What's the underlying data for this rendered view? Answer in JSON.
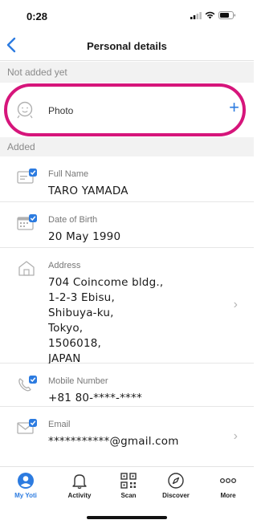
{
  "status_bar": {
    "time": "0:28",
    "icons": [
      "signal-icon",
      "wifi-icon",
      "battery-icon"
    ]
  },
  "header": {
    "title": "Personal details",
    "back_icon": "chevron-left-icon"
  },
  "sections": {
    "not_added": "Not added yet",
    "added": "Added"
  },
  "photo": {
    "label": "Photo",
    "add_label": "+"
  },
  "details": [
    {
      "label": "Full Name",
      "value": "TARO YAMADA",
      "icon": "id-card-verified-icon",
      "chevron": ""
    },
    {
      "label": "Date of Birth",
      "value": "20 May 1990",
      "icon": "calendar-verified-icon",
      "chevron": ""
    },
    {
      "label": "Address",
      "value": "704 Coincome bldg.,\n1-2-3 Ebisu,\nShibuya-ku,\nTokyo,\n1506018,\nJAPAN",
      "icon": "house-icon",
      "chevron": "›"
    },
    {
      "label": "Mobile Number",
      "value": "+81 80-****-****",
      "icon": "phone-verified-icon",
      "chevron": ""
    },
    {
      "label": "Email",
      "value": "***********@gmail.com",
      "icon": "envelope-verified-icon",
      "chevron": "›"
    }
  ],
  "tabs": [
    {
      "label": "My Yoti",
      "icon": "person-circle-icon",
      "active": true
    },
    {
      "label": "Activity",
      "icon": "bell-icon",
      "active": false
    },
    {
      "label": "Scan",
      "icon": "qr-code-icon",
      "active": false
    },
    {
      "label": "Discover",
      "icon": "compass-icon",
      "active": false
    },
    {
      "label": "More",
      "icon": "more-dots-icon",
      "active": false
    }
  ],
  "colors": {
    "accent": "#2c7be0",
    "highlight": "#d6157b",
    "section_bg": "#f2f2f2"
  }
}
